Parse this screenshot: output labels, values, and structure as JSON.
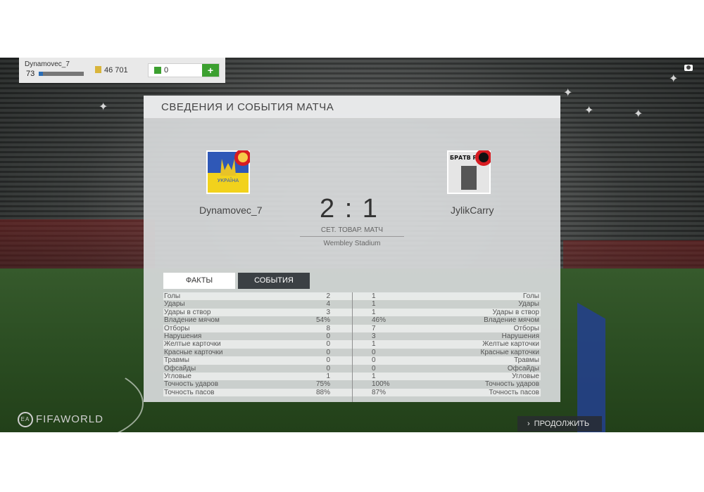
{
  "hud": {
    "username": "Dynamovec_7",
    "level": "73",
    "level_progress": 0.1,
    "coins": "46 701",
    "points": "0",
    "add_button": "+"
  },
  "panel": {
    "title": "СВЕДЕНИЯ И СОБЫТИЯ МАТЧА",
    "home_team": "Dynamovec_7",
    "away_team": "JylikCarry",
    "score": "2 : 1",
    "match_type": "СЕТ. ТОВАР. МАТЧ",
    "stadium": "Wembley Stadium",
    "home_badge_text": "УКРАЇНА",
    "away_badge_text": "БРАТВ РВЕТС"
  },
  "tabs": {
    "facts": "ФАКТЫ",
    "events": "СОБЫТИЯ"
  },
  "stats": [
    {
      "label": "Голы",
      "home": "2",
      "away": "1"
    },
    {
      "label": "Удары",
      "home": "4",
      "away": "1"
    },
    {
      "label": "Удары в створ",
      "home": "3",
      "away": "1"
    },
    {
      "label": "Владение мячом",
      "home": "54%",
      "away": "46%"
    },
    {
      "label": "Отборы",
      "home": "8",
      "away": "7"
    },
    {
      "label": "Нарушения",
      "home": "0",
      "away": "3"
    },
    {
      "label": "Желтые карточки",
      "home": "0",
      "away": "1"
    },
    {
      "label": "Красные карточки",
      "home": "0",
      "away": "0"
    },
    {
      "label": "Травмы",
      "home": "0",
      "away": "0"
    },
    {
      "label": "Офсайды",
      "home": "0",
      "away": "0"
    },
    {
      "label": "Угловые",
      "home": "1",
      "away": "1"
    },
    {
      "label": "Точность ударов",
      "home": "75%",
      "away": "100%"
    },
    {
      "label": "Точность пасов",
      "home": "88%",
      "away": "87%"
    }
  ],
  "footer": {
    "logo": "FIFAWORLD",
    "ea": "EA",
    "continue": "ПРОДОЛЖИТЬ"
  },
  "icons": {
    "camera": "camera-icon",
    "coins": "coins-icon",
    "points": "points-icon",
    "continue": "chevron-right-icon"
  },
  "colors": {
    "accent_green": "#3ca030",
    "tab_dark": "#3b4044",
    "level_bar": "#2a6db5"
  }
}
